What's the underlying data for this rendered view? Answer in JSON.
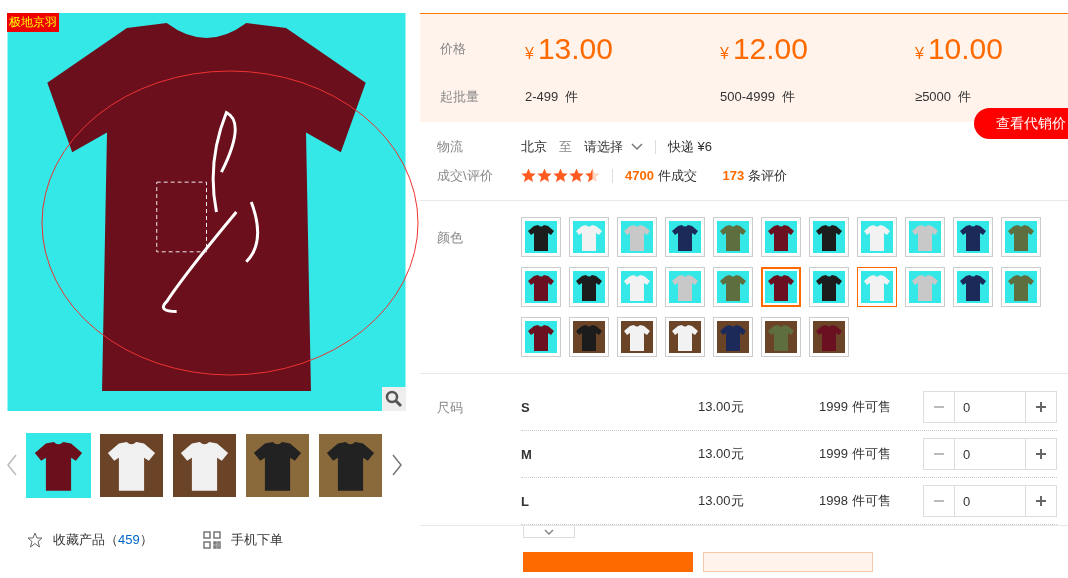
{
  "gallery": {
    "badge": "极地京羽",
    "thumbnails": [
      {
        "kind": "studio",
        "selected": true
      },
      {
        "kind": "wood",
        "selected": false
      },
      {
        "kind": "wood",
        "selected": false
      },
      {
        "kind": "mannequin",
        "selected": false
      },
      {
        "kind": "mannequin",
        "selected": false
      }
    ],
    "favorite": {
      "label": "收藏产品（",
      "count": "459",
      "close": "）"
    },
    "mobile_order": "手机下单"
  },
  "pricing": {
    "price_label": "价格",
    "quantity_label": "起批量",
    "tiers": [
      {
        "currency": "¥",
        "amount": "13.00",
        "quantity": "2-499",
        "unit": "件"
      },
      {
        "currency": "¥",
        "amount": "12.00",
        "quantity": "500-4999",
        "unit": "件"
      },
      {
        "currency": "¥",
        "amount": "10.00",
        "quantity": "≥5000",
        "unit": "件"
      }
    ],
    "dropship_button": "查看代销价"
  },
  "logistics": {
    "label": "物流",
    "from": "北京",
    "to": "至",
    "destination": "请选择",
    "shipping": "快递 ¥6"
  },
  "rating": {
    "label": "成交\\评价",
    "stars": 4.5,
    "sales_count": "4700",
    "sales_suffix": "件成交",
    "review_count": "173",
    "review_suffix": "条评价"
  },
  "colors": {
    "label": "颜色",
    "swatches": [
      {
        "color": "#1c1c1c",
        "kind": "studio",
        "selected": false,
        "highlighted": false
      },
      {
        "color": "#f2f2f2",
        "kind": "studio",
        "selected": false,
        "highlighted": false
      },
      {
        "color": "#c8c8c8",
        "kind": "studio",
        "selected": false,
        "highlighted": false
      },
      {
        "color": "#1c2a5a",
        "kind": "studio",
        "selected": false,
        "highlighted": false
      },
      {
        "color": "#5f6e3f",
        "kind": "studio",
        "selected": false,
        "highlighted": false
      },
      {
        "color": "#6a1020",
        "kind": "studio",
        "selected": false,
        "highlighted": false
      },
      {
        "color": "#1c1c1c",
        "kind": "studio",
        "selected": false,
        "highlighted": false
      },
      {
        "color": "#f2f2f2",
        "kind": "studio",
        "selected": false,
        "highlighted": false
      },
      {
        "color": "#c8c8c8",
        "kind": "studio",
        "selected": false,
        "highlighted": false
      },
      {
        "color": "#1c2a5a",
        "kind": "studio",
        "selected": false,
        "highlighted": false
      },
      {
        "color": "#5f6e3f",
        "kind": "studio",
        "selected": false,
        "highlighted": false
      },
      {
        "color": "#6a1020",
        "kind": "studio",
        "selected": false,
        "highlighted": false
      },
      {
        "color": "#1c1c1c",
        "kind": "studio",
        "selected": false,
        "highlighted": false
      },
      {
        "color": "#f2f2f2",
        "kind": "studio",
        "selected": false,
        "highlighted": false
      },
      {
        "color": "#c8c8c8",
        "kind": "studio",
        "selected": false,
        "highlighted": false
      },
      {
        "color": "#5f6e3f",
        "kind": "studio",
        "selected": false,
        "highlighted": false
      },
      {
        "color": "#6a1020",
        "kind": "studio",
        "selected": true,
        "highlighted": false
      },
      {
        "color": "#1c1c1c",
        "kind": "studio",
        "selected": false,
        "highlighted": false
      },
      {
        "color": "#f2f2f2",
        "kind": "studio",
        "selected": false,
        "highlighted": true
      },
      {
        "color": "#c8c8c8",
        "kind": "studio",
        "selected": false,
        "highlighted": false
      },
      {
        "color": "#1c2a5a",
        "kind": "studio",
        "selected": false,
        "highlighted": false
      },
      {
        "color": "#5f6e3f",
        "kind": "studio",
        "selected": false,
        "highlighted": false
      },
      {
        "color": "#6a1020",
        "kind": "studio",
        "selected": false,
        "highlighted": false
      },
      {
        "color": "#1c1c1c",
        "kind": "wood",
        "selected": false,
        "highlighted": false
      },
      {
        "color": "#f2f2f2",
        "kind": "wood",
        "selected": false,
        "highlighted": false
      },
      {
        "color": "#f2f2f2",
        "kind": "wood",
        "selected": false,
        "highlighted": false
      },
      {
        "color": "#1c2a5a",
        "kind": "wood",
        "selected": false,
        "highlighted": false
      },
      {
        "color": "#5f6e3f",
        "kind": "wood",
        "selected": false,
        "highlighted": false
      },
      {
        "color": "#6a1020",
        "kind": "wood",
        "selected": false,
        "highlighted": false
      }
    ]
  },
  "sizes": {
    "label": "尺码",
    "rows": [
      {
        "size": "S",
        "price": "13.00元",
        "stock": "1999 件可售",
        "quantity": "0",
        "decrease_disabled": true
      },
      {
        "size": "M",
        "price": "13.00元",
        "stock": "1999 件可售",
        "quantity": "0",
        "decrease_disabled": true
      },
      {
        "size": "L",
        "price": "13.00元",
        "stock": "1998 件可售",
        "quantity": "0",
        "decrease_disabled": true
      }
    ]
  }
}
